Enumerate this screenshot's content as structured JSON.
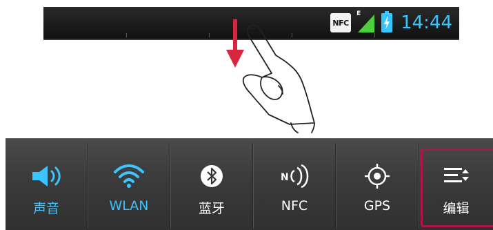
{
  "status_bar": {
    "nfc_badge": "NFC",
    "network_type": "E",
    "time": "14:44"
  },
  "quick_settings": [
    {
      "label": "声音",
      "icon": "volume-icon",
      "active": true
    },
    {
      "label": "WLAN",
      "icon": "wifi-icon",
      "active": true
    },
    {
      "label": "蓝牙",
      "icon": "bluetooth-icon",
      "active": false
    },
    {
      "label": "NFC",
      "icon": "nfc-icon",
      "active": false
    },
    {
      "label": "GPS",
      "icon": "gps-icon",
      "active": false
    },
    {
      "label": "编辑",
      "icon": "edit-list-icon",
      "active": false
    }
  ],
  "colors": {
    "accent": "#3cc4ff",
    "highlight_frame": "#b0134d",
    "arrow": "#d9263f"
  }
}
